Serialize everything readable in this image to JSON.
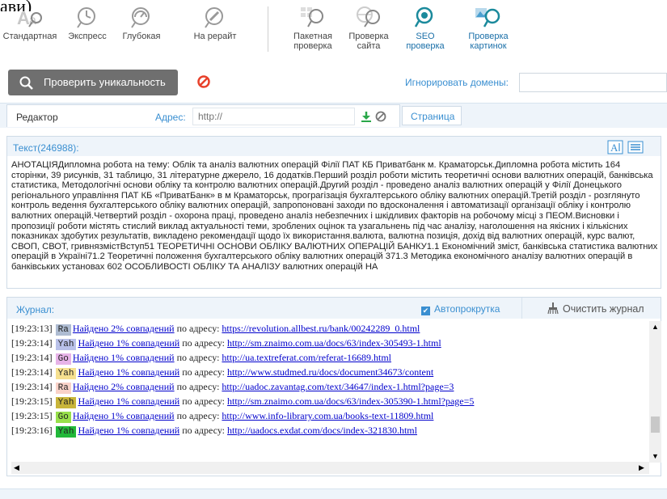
{
  "top_fragment": "ави)",
  "toolbar": {
    "items": [
      {
        "label": "Стандартная",
        "icon": "aa-letters-icon"
      },
      {
        "label": "Экспресс",
        "icon": "clock-icon"
      },
      {
        "label": "Глубокая",
        "icon": "gauge-icon"
      },
      {
        "label": "На рерайт",
        "icon": "pencil-icon"
      },
      {
        "label": "Пакетная проверка",
        "icon": "batch-search-icon"
      },
      {
        "label": "Проверка сайта",
        "icon": "globe-search-icon"
      },
      {
        "label": "SEO проверка",
        "icon": "seo-search-icon"
      },
      {
        "label": "Проверка картинок",
        "icon": "image-search-icon"
      }
    ]
  },
  "action": {
    "check_label": "Проверить уникальность",
    "ignore_label": "Игнорировать домены:",
    "ignore_value": ""
  },
  "editor": {
    "tab_label": "Редактор",
    "address_label": "Адрес:",
    "address_placeholder": "http://",
    "page_tab": "Страница"
  },
  "text_panel": {
    "title": "Текст(246988):",
    "body": "АНОТАЦІЯДипломна робота на тему: Облік та аналіз валютних операцій  Філії ПАТ КБ Приватбанк м. Краматорськ.Дипломна робота містить 164 сторінки, 39 рисунків, 31 таблицю, 31 літературне джерело, 16 додатків.Перший розділ роботи містить теоретичні основи валютних операцій, банківська статистика, Методологічні основи обліку та контролю валютних операцій.Другий розділ - проведено аналіз валютних операцій у Філії Донецького регіонального управління ПАТ КБ «ПриватБанк» в м Краматорськ, програгізація бухгалтерського обліку валютних операцій.Третій розділ - розглянуто контроль ведення бухгалтерського обліку валютних операцій, запропоновані заходи по вдосконалення і автоматизації організації обліку і контролю валютних операцій.Четвертий розділ - охорона праці, проведено аналіз небезпечних і шкідливих факторів на робочому місці з ПЕОМ.Висновки і пропозиції роботи містять стислий виклад актуальності теми, зроблених оцінок та узагальнень під час аналізу, наголошення на якісних і кількісних показниках здобутих результатів, викладено рекомендації щодо їх використання.валюта, валютна позиція, дохід від валютних операцій, курс валют, СВОП, СВОТ, гривнязмістВступ51 ТЕОРЕТИЧНІ ОСНОВИ ОБЛІКУ ВАЛЮТНИХ ОПЕРАЦІЙ БАНКУ1.1 Економічний зміст, банківська статистика валютних операцій в Україні71.2 Теоретичні положення бухгалтерського обліку валютних операцій 371.3 Методика економічного аналізу валютних операцій в банківських установах 602 ОСОБЛИВОСТІ ОБЛІКУ ТА АНАЛІЗУ валютних операцій НА"
  },
  "log": {
    "title": "Журнал:",
    "autoscroll_label": "Автопрокрутка",
    "clear_label": "Очистить журнал",
    "rows": [
      {
        "time": "[19:23:13]",
        "engine": "Ra",
        "engine_color": "#aebcd2",
        "match": "Найдено 2% совпадений",
        "mid": " по адресу: ",
        "url": "https://revolution.allbest.ru/bank/00242289_0.html"
      },
      {
        "time": "[19:23:14]",
        "engine": "Yah",
        "engine_color": "#b9c1ea",
        "match": "Найдено 1% совпадений",
        "mid": " по адресу: ",
        "url": "http://sm.znaimo.com.ua/docs/63/index-305493-1.html"
      },
      {
        "time": "[19:23:14]",
        "engine": "Go",
        "engine_color": "#e7b3e8",
        "match": "Найдено 1% совпадений",
        "mid": " по адресу: ",
        "url": "http://ua.textreferat.com/referat-16689.html"
      },
      {
        "time": "[19:23:14]",
        "engine": "Yah",
        "engine_color": "#f6e08f",
        "match": "Найдено 1% совпадений",
        "mid": " по адресу: ",
        "url": "http://www.studmed.ru/docs/document34673/content"
      },
      {
        "time": "[19:23:14]",
        "engine": "Ra",
        "engine_color": "#f9d2c8",
        "match": "Найдено 2% совпадений",
        "mid": " по адресу: ",
        "url": "http://uadoc.zavantag.com/text/34647/index-1.html?page=3"
      },
      {
        "time": "[19:23:15]",
        "engine": "Yah",
        "engine_color": "#c9b53a",
        "match": "Найдено 1% совпадений",
        "mid": " по адресу: ",
        "url": "http://sm.znaimo.com.ua/docs/63/index-305390-1.html?page=5"
      },
      {
        "time": "[19:23:15]",
        "engine": "Go",
        "engine_color": "#98e04b",
        "match": "Найдено 1% совпадений",
        "mid": " по адресу: ",
        "url": "http://www.info-library.com.ua/books-text-11809.html"
      },
      {
        "time": "[19:23:16]",
        "engine": "Yah",
        "engine_color": "#22b83a",
        "match": "Найдено 1% совпадений",
        "mid": " по адресу: ",
        "url": "http://uadocs.exdat.com/docs/index-321830.html"
      }
    ]
  }
}
